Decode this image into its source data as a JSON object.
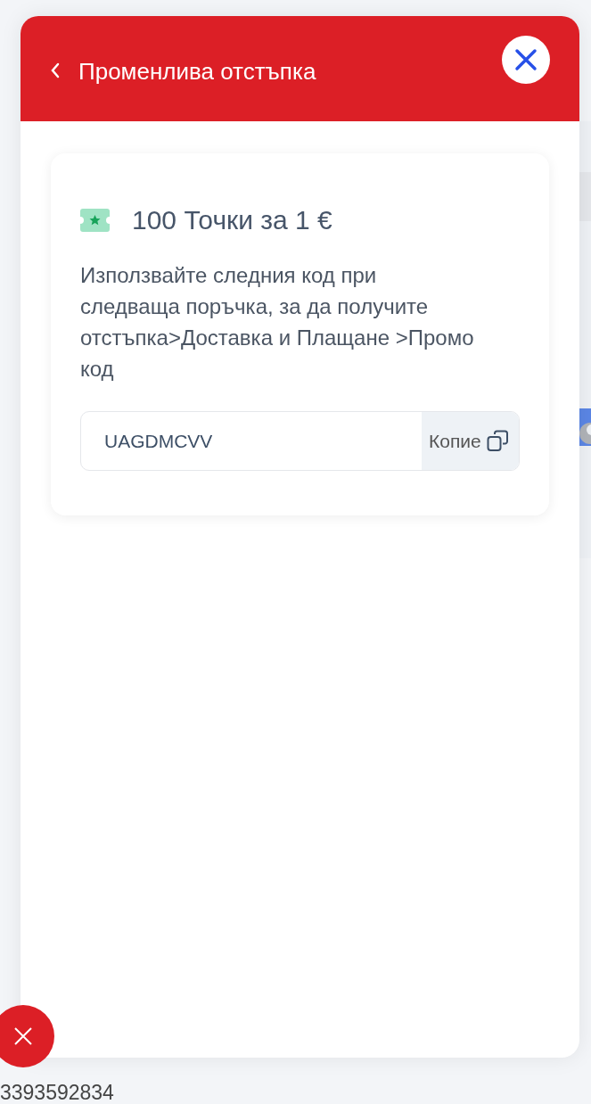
{
  "background": {
    "footer_number": "3393592834"
  },
  "sheet": {
    "title": "Променлива отстъпка"
  },
  "voucher": {
    "title": "100 Точки за 1 €",
    "description": "Използвайте следния код при следваща поръчка, за да получите отстъпка>Доставка и Плащане >Промо код",
    "code": "UAGDMCVV",
    "copy_label": "Копие"
  }
}
